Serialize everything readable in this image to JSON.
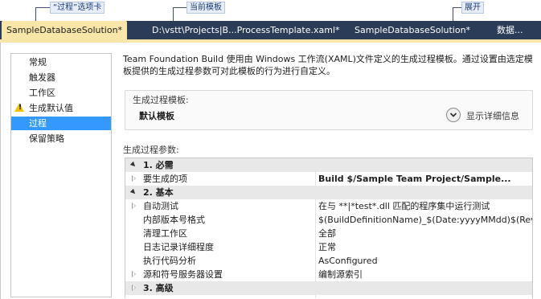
{
  "annotations": {
    "tab": "“过程”选项卡",
    "current_template": "当前模板",
    "expand": "展开"
  },
  "tabs": [
    {
      "label": "SampleDatabaseSolution*",
      "active": true
    },
    {
      "label": "D:\\vstt\\Projects|B...ProcessTemplate.xaml*",
      "active": false
    },
    {
      "label": "SampleDatabaseSolution*",
      "active": false
    },
    {
      "label": "数据...",
      "active": false
    }
  ],
  "nav": {
    "items": [
      {
        "label": "常规",
        "warning": false,
        "selected": false
      },
      {
        "label": "触发器",
        "warning": false,
        "selected": false
      },
      {
        "label": "工作区",
        "warning": false,
        "selected": false
      },
      {
        "label": "生成默认值",
        "warning": true,
        "selected": false
      },
      {
        "label": "过程",
        "warning": false,
        "selected": true
      },
      {
        "label": "保留策略",
        "warning": false,
        "selected": false
      }
    ]
  },
  "description": "Team Foundation Build 使用由 Windows 工作流(XAML)文件定义的生成过程模板。通过设置由选定模板提供的生成过程参数可对此模板的行为进行自定义。",
  "template": {
    "label": "生成过程模板:",
    "value": "默认模板",
    "expand_label": "显示详细信息",
    "expand_icon": "chevron-down-icon"
  },
  "params": {
    "title": "生成过程参数:",
    "rows": [
      {
        "kind": "category",
        "expander": "open",
        "key": "1. 必需",
        "value": ""
      },
      {
        "kind": "item",
        "expander": "closed",
        "key": "要生成的项",
        "value": "Build $/Sample Team Project/Sample...",
        "bold": true
      },
      {
        "kind": "category",
        "expander": "open",
        "key": "2. 基本",
        "value": ""
      },
      {
        "kind": "item",
        "expander": "closed",
        "key": "自动测试",
        "value": "在与 **|*test*.dll 匹配的程序集中运行测试",
        "bold": false
      },
      {
        "kind": "item",
        "expander": "",
        "key": "内部版本号格式",
        "value": "$(BuildDefinitionName)_$(Date:yyyyMMdd)$(Rev:.r)",
        "bold": false
      },
      {
        "kind": "item",
        "expander": "",
        "key": "清理工作区",
        "value": "全部",
        "bold": false
      },
      {
        "kind": "item",
        "expander": "",
        "key": "日志记录详细程度",
        "value": "正常",
        "bold": false
      },
      {
        "kind": "item",
        "expander": "",
        "key": "执行代码分析",
        "value": "AsConfigured",
        "bold": false
      },
      {
        "kind": "item",
        "expander": "closed",
        "key": "源和符号服务器设置",
        "value": "编制源索引",
        "bold": false
      },
      {
        "kind": "category",
        "expander": "closed",
        "key": "3. 高级",
        "value": ""
      }
    ]
  },
  "colors": {
    "tab_bar": "#2b3c59",
    "active_tab": "#f7e6a7",
    "selection": "#3399ff",
    "warning": "#f5c400"
  }
}
